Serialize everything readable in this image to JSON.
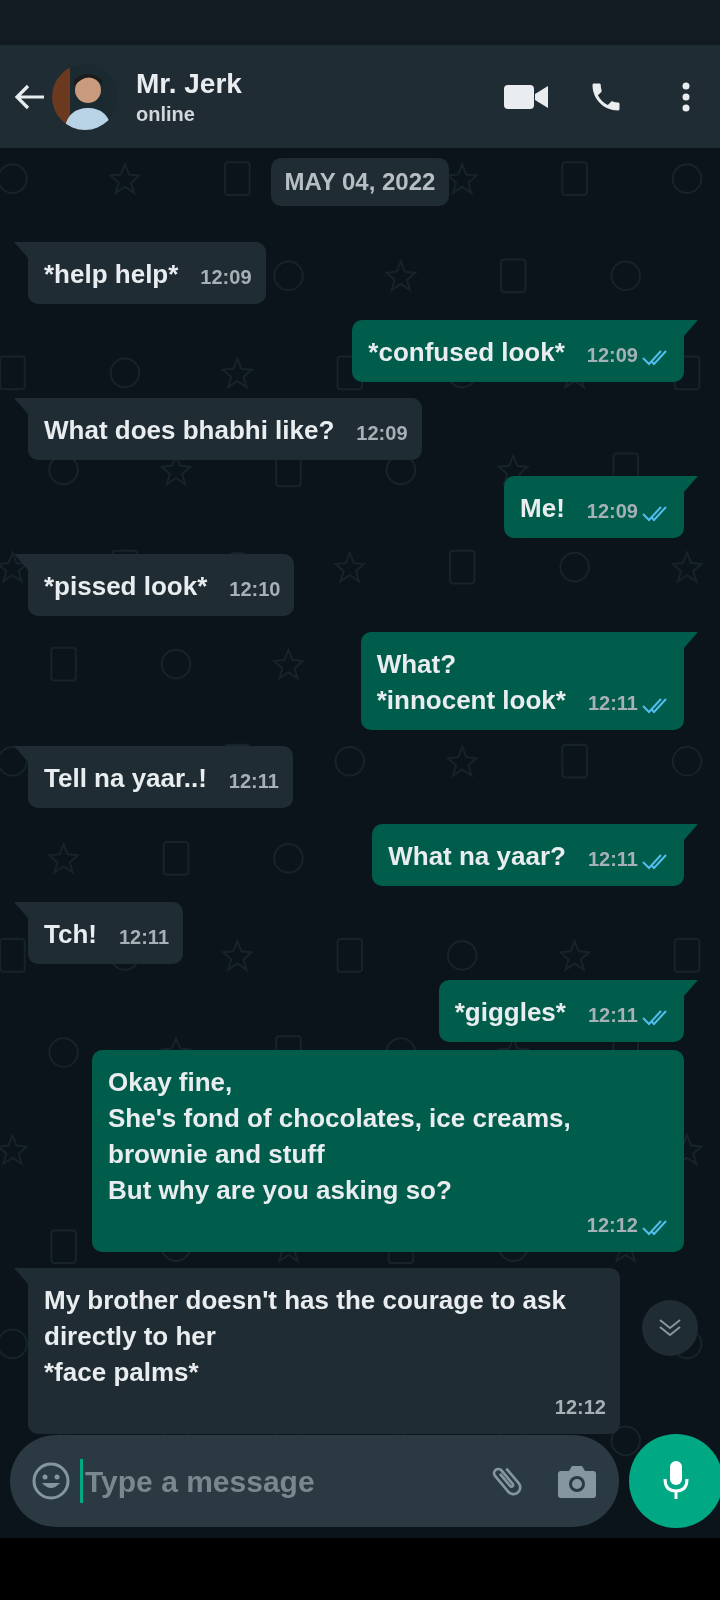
{
  "header": {
    "contact_name": "Mr. Jerk",
    "status": "online"
  },
  "date_chip": "MAY 04, 2022",
  "messages": [
    {
      "kind": "incoming",
      "tail": true,
      "text": "*help help*",
      "time": "12:09"
    },
    {
      "kind": "outgoing",
      "tail": true,
      "text": "*confused look*",
      "time": "12:09",
      "read": true
    },
    {
      "kind": "incoming",
      "tail": true,
      "text": "What does bhabhi like?",
      "time": "12:09"
    },
    {
      "kind": "outgoing",
      "tail": true,
      "text": "Me!",
      "time": "12:09",
      "read": true
    },
    {
      "kind": "incoming",
      "tail": true,
      "text": "*pissed look*",
      "time": "12:10"
    },
    {
      "kind": "outgoing",
      "tail": true,
      "text": "What?\n*innocent look*",
      "time": "12:11",
      "read": true
    },
    {
      "kind": "incoming",
      "tail": true,
      "text": "Tell na yaar..!",
      "time": "12:11"
    },
    {
      "kind": "outgoing",
      "tail": true,
      "text": "What na yaar?",
      "time": "12:11",
      "read": true
    },
    {
      "kind": "incoming",
      "tail": true,
      "text": "Tch!",
      "time": "12:11"
    },
    {
      "kind": "outgoing",
      "tail": true,
      "text": "*giggles*",
      "time": "12:11",
      "read": true
    },
    {
      "kind": "outgoing",
      "tail": false,
      "text": "Okay fine,\nShe's fond of chocolates, ice creams,\nbrownie and stuff\nBut why are you asking so?",
      "time": "12:12",
      "read": true
    },
    {
      "kind": "incoming",
      "tail": true,
      "text": "My brother doesn't has the courage to ask\ndirectly to her\n*face palms*",
      "time": "12:12"
    }
  ],
  "composer": {
    "placeholder": "Type a message"
  }
}
